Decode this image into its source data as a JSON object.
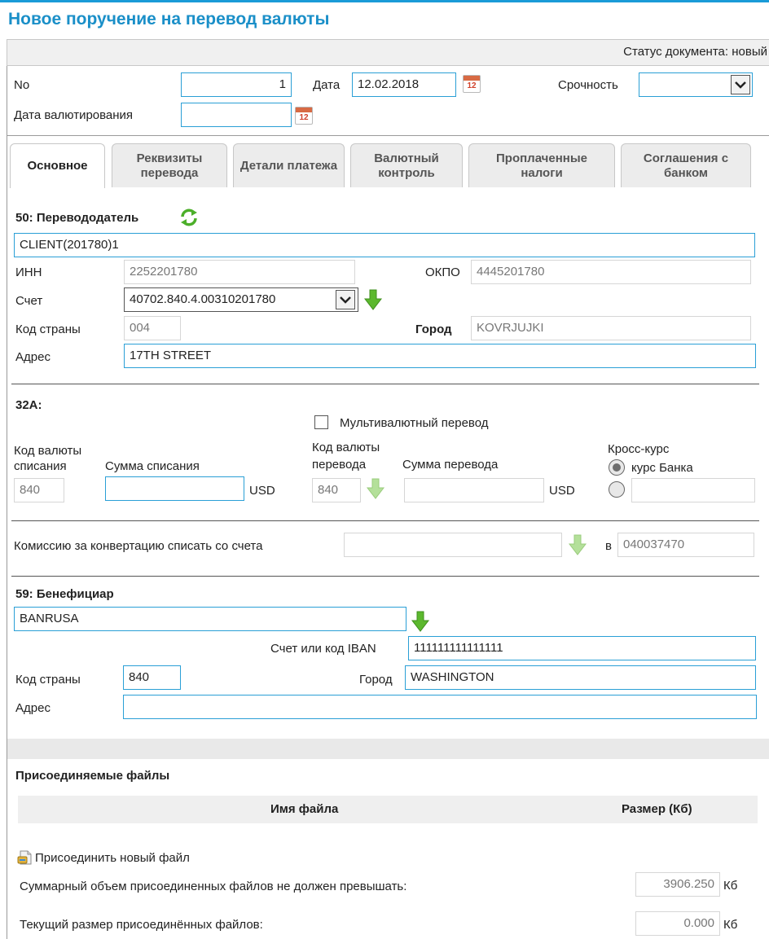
{
  "page": {
    "title": "Новое поручение на перевод валюты",
    "status_label": "Статус документа:",
    "status_value": "новый"
  },
  "header": {
    "no_label": "No",
    "no_value": "1",
    "date_label": "Дата",
    "date_value": "12.02.2018",
    "urgency_label": "Срочность",
    "urgency_value": "",
    "value_date_label": "Дата валютирования",
    "value_date_value": "",
    "calendar_text": "12"
  },
  "tabs": [
    {
      "label": "Основное"
    },
    {
      "label": "Реквизиты перевода"
    },
    {
      "label": "Детали платежа"
    },
    {
      "label": "Валютный контроль"
    },
    {
      "label": "Проплаченные налоги"
    },
    {
      "label": "Соглашения с банком"
    }
  ],
  "sender": {
    "heading": "50: Перевододатель",
    "name": "CLIENT(201780)1",
    "inn_label": "ИНН",
    "inn_value": "2252201780",
    "okpo_label": "ОКПО",
    "okpo_value": "4445201780",
    "account_label": "Счет",
    "account_value": "40702.840.4.00310201780",
    "country_code_label": "Код страны",
    "country_code_value": "004",
    "city_label": "Город",
    "city_value": "KOVRJUJKI",
    "address_label": "Адрес",
    "address_value": "17TH STREET"
  },
  "amount": {
    "heading": "32A:",
    "multicurrency_label": "Мультивалютный перевод",
    "multicurrency_checked": false,
    "debit_currency_label_1": "Код валюты",
    "debit_currency_label_2": "списания",
    "debit_currency_value": "840",
    "debit_amount_label": "Сумма списания",
    "debit_amount_value": "",
    "debit_currency_code": "USD",
    "transfer_currency_label_1": "Код валюты",
    "transfer_currency_label_2": "перевода",
    "transfer_currency_value": "840",
    "transfer_amount_label": "Сумма перевода",
    "transfer_amount_value": "",
    "transfer_currency_code": "USD",
    "cross_rate_label": "Кросс-курс",
    "bank_rate_label": "курс Банка",
    "custom_rate_value": ""
  },
  "commission": {
    "label": "Комиссию за конвертацию списать со счета",
    "account_value": "",
    "in_label": "в",
    "bik_value": "040037470"
  },
  "beneficiary": {
    "heading": "59: Бенефициар",
    "name": "BANRUSA",
    "iban_label": "Счет или код IBAN",
    "iban_value": "111111111111111",
    "country_code_label": "Код страны",
    "country_code_value": "840",
    "city_label": "Город",
    "city_value": "WASHINGTON",
    "address_label": "Адрес",
    "address_value": ""
  },
  "files": {
    "heading": "Присоединяемые файлы",
    "col_name": "Имя файла",
    "col_size": "Размер (Кб)",
    "attach_label": "Присоединить новый файл",
    "limit_label": "Суммарный объем присоединенных файлов не должен превышать:",
    "limit_value": "3906.250",
    "limit_unit": "Кб",
    "current_label": "Текущий размер присоединённых файлов:",
    "current_value": "0.000",
    "current_unit": "Кб"
  },
  "colors": {
    "accent": "#1a8fc8",
    "input_border": "#2a9fd6",
    "arrow_green": "#5cb82e"
  }
}
